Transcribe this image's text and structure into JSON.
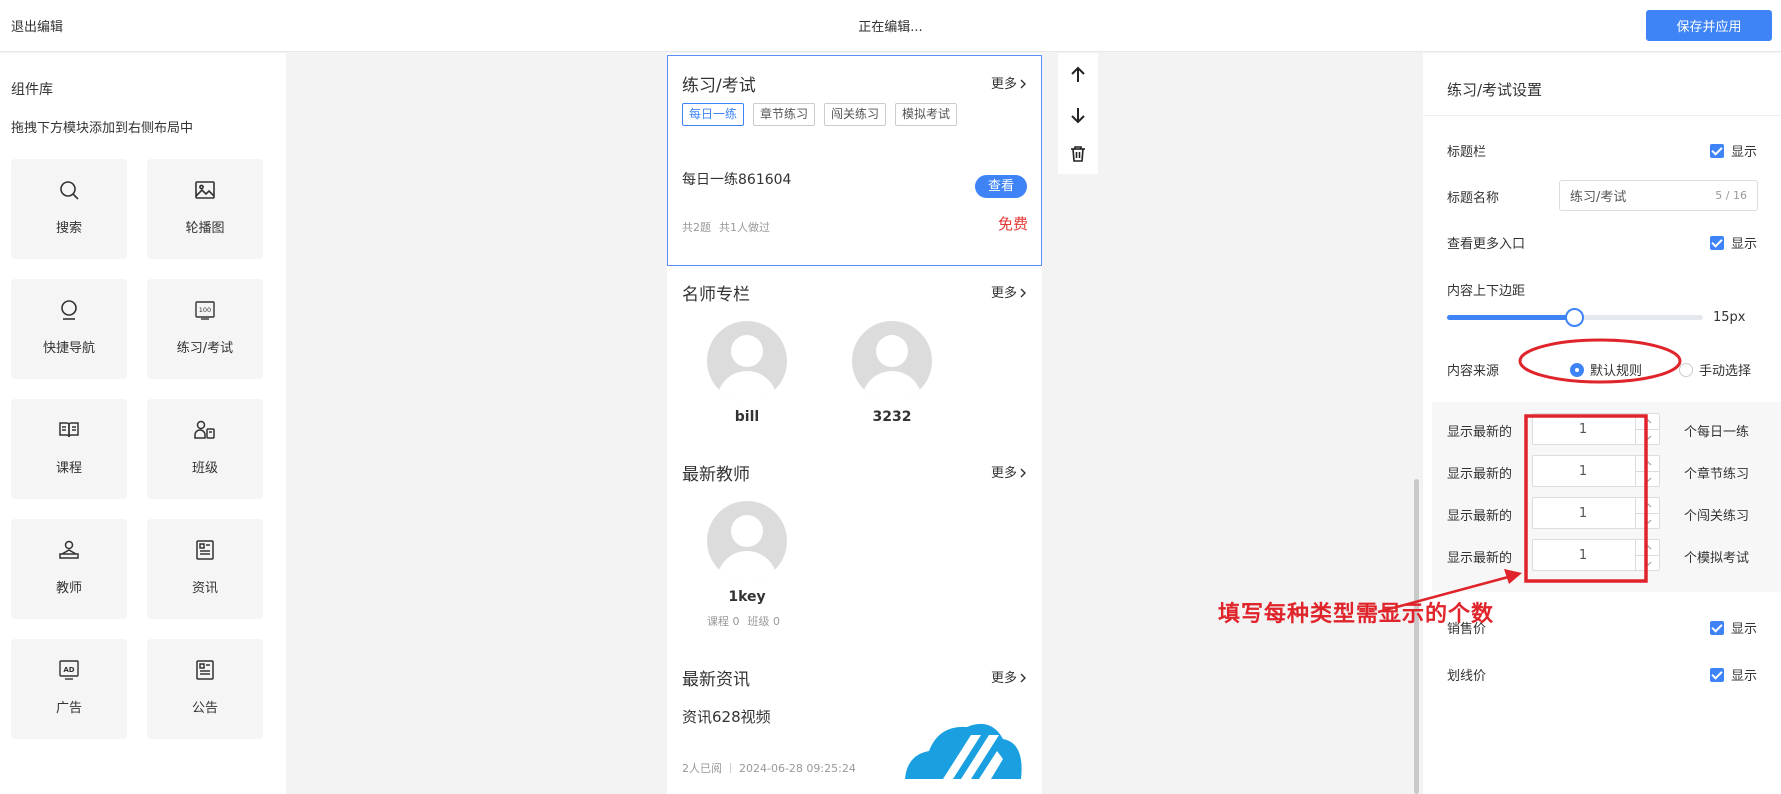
{
  "topbar": {
    "exit_label": "退出编辑",
    "status_label": "正在编辑...",
    "save_label": "保存并应用"
  },
  "library": {
    "title": "组件库",
    "hint": "拖拽下方模块添加到右侧布局中",
    "items": [
      {
        "label": "搜索",
        "icon": "search-icon"
      },
      {
        "label": "轮播图",
        "icon": "image-icon"
      },
      {
        "label": "快捷导航",
        "icon": "pin-icon"
      },
      {
        "label": "练习/考试",
        "icon": "score-icon"
      },
      {
        "label": "课程",
        "icon": "book-icon"
      },
      {
        "label": "班级",
        "icon": "group-icon"
      },
      {
        "label": "教师",
        "icon": "teacher-icon"
      },
      {
        "label": "资讯",
        "icon": "news-icon"
      },
      {
        "label": "广告",
        "icon": "ad-icon"
      },
      {
        "label": "公告",
        "icon": "notice-icon"
      }
    ]
  },
  "preview": {
    "exam": {
      "title": "练习/考试",
      "more": "更多",
      "tabs": [
        "每日一练",
        "章节练习",
        "闯关练习",
        "模拟考试"
      ],
      "item_name": "每日一练861604",
      "view_label": "查看",
      "total": "共2题",
      "done": "共1人做过",
      "price": "免费"
    },
    "famous": {
      "title": "名师专栏",
      "more": "更多",
      "teachers": [
        "bill",
        "3232"
      ]
    },
    "teachers": {
      "title": "最新教师",
      "more": "更多",
      "name": "1key",
      "courses": "课程 0",
      "classes": "班级 0"
    },
    "news": {
      "title": "最新资讯",
      "more": "更多",
      "item_title": "资讯628视频",
      "reads": "2人已阅",
      "date": "2024-06-28 09:25:24"
    }
  },
  "settings": {
    "title": "练习/考试设置",
    "title_bar_label": "标题栏",
    "show_label": "显示",
    "title_name_label": "标题名称",
    "title_name_value": "练习/考试",
    "title_name_count": "5 / 16",
    "more_entry_label": "查看更多入口",
    "padding_label": "内容上下边距",
    "padding_value": "15px",
    "padding_fraction": 0.5,
    "source_label": "内容来源",
    "source_default": "默认规则",
    "source_manual": "手动选择",
    "count_rows": [
      {
        "label": "显示最新的",
        "value": "1",
        "unit": "个每日一练"
      },
      {
        "label": "显示最新的",
        "value": "1",
        "unit": "个章节练习"
      },
      {
        "label": "显示最新的",
        "value": "1",
        "unit": "个闯关练习"
      },
      {
        "label": "显示最新的",
        "value": "1",
        "unit": "个模拟考试"
      }
    ],
    "sale_price_label": "销售价",
    "strike_price_label": "划线价"
  },
  "annotation": {
    "text": "填写每种类型需显示的个数",
    "color": "#e0242b"
  },
  "colors": {
    "accent": "#3f84f7",
    "price": "#e53935"
  }
}
